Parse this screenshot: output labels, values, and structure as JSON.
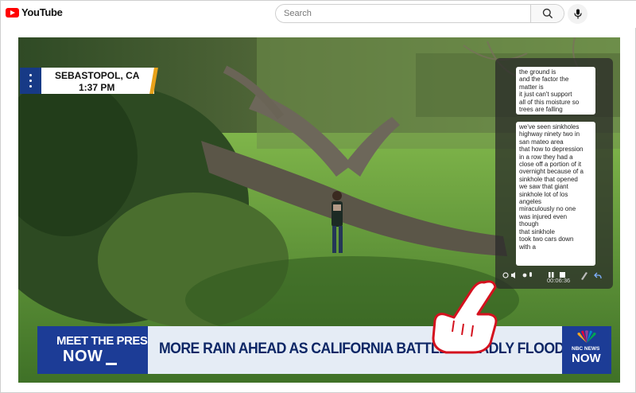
{
  "app": {
    "logo_text": "YouTube"
  },
  "search": {
    "placeholder": "Search"
  },
  "video": {
    "location": {
      "city": "SEBASTOPOL, CA",
      "time": "1:37 PM"
    },
    "captions": {
      "bubble_1": [
        "the ground is",
        "and the factor the",
        "matter is",
        "it just can't support",
        "all of this moisture so",
        "trees are falling"
      ],
      "bubble_2": [
        "we've seen sinkholes",
        "highway ninety two in",
        "san mateo area",
        "that how to depression",
        "in a row they had a",
        "close off a portion of it",
        "overnight because of a",
        "sinkhole that opened",
        "we saw that giant",
        "sinkhole lot of los",
        "angeles",
        "miraculously no one",
        "was injured even",
        "though",
        "that sinkhole",
        "took two cars down",
        "with a"
      ],
      "elapsed": "00:06:36"
    },
    "lower_third": {
      "show_top": "MEET THE PRESS",
      "show_bottom": "NOW",
      "headline": "MORE RAIN AHEAD AS CALIFORNIA BATTLES DEADLY FLOODING",
      "network_label": "NBC NEWS",
      "network_now": "NOW"
    }
  },
  "colors": {
    "brand_red": "#ff0000",
    "mtp_blue": "#1c3c96",
    "headline_text": "#0e2766",
    "location_stripe": "#e8a21a"
  }
}
